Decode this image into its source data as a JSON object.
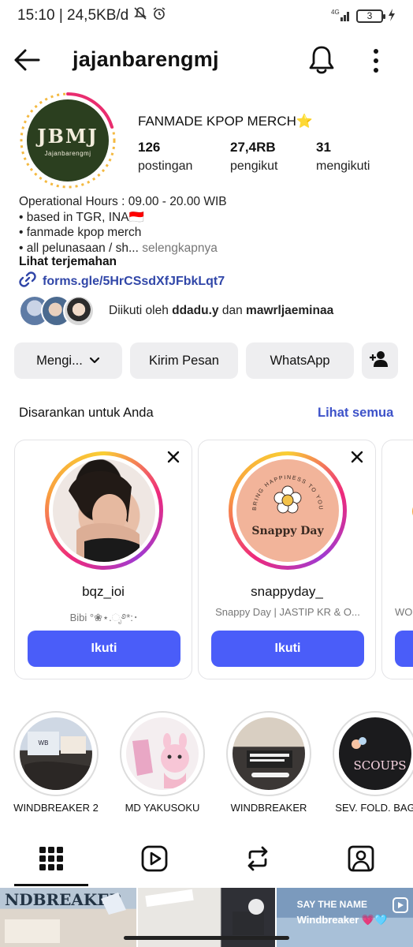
{
  "status_bar": {
    "time_info": "15:10 | 24,5KB/d",
    "network": "4G",
    "battery": "3"
  },
  "header": {
    "username": "jajanbarengmj",
    "back_icon": "arrow-left-icon",
    "bell_icon": "bell-icon",
    "more_icon": "more-vertical-icon"
  },
  "profile": {
    "avatar_logo": "JBMJ",
    "avatar_sub": "Jajanbarengmj",
    "display_name": "FANMADE KPOP MERCH⭐",
    "posts_count": "126",
    "posts_label": "postingan",
    "followers_count": "27,4RB",
    "followers_label": "pengikut",
    "following_count": "31",
    "following_label": "mengikuti"
  },
  "bio": {
    "line1": "Operational Hours : 09.00 - 20.00 WIB",
    "line2": "• based in TGR, INA🇮🇩",
    "line3": "• fanmade kpop merch",
    "line4": "• all pelunasaan / sh...",
    "more": "selengkapnya",
    "translate": "Lihat terjemahan",
    "link": "forms.gle/5HrCSsdXfJFbkLqt7"
  },
  "followed_by": {
    "prefix": "Diikuti oleh",
    "user1": "ddadu.y",
    "joiner": "dan",
    "user2": "mawrljaeminaa"
  },
  "actions": {
    "following": "Mengi...",
    "message": "Kirim Pesan",
    "whatsapp": "WhatsApp"
  },
  "suggestions": {
    "title": "Disarankan untuk Anda",
    "see_all": "Lihat semua",
    "cards": [
      {
        "username": "bqz_ioi",
        "desc": "Bibi °❀⋆.ೃ࿔*:･",
        "follow": "Ikuti"
      },
      {
        "username": "snappyday_",
        "desc": "Snappy Day | JASTIP KR & O...",
        "follow": "Ikuti",
        "logo": "Snappy Day",
        "ring_text": "BRING HAPPINESS TO YOU"
      },
      {
        "desc": "WO"
      }
    ]
  },
  "highlights": [
    {
      "label": "WINDBREAKER 2"
    },
    {
      "label": "MD YAKUSOKU"
    },
    {
      "label": "WINDBREAKER"
    },
    {
      "label": "SEV. FOLD. BAG"
    }
  ],
  "tabs": [
    "grid-icon",
    "reels-icon",
    "repost-icon",
    "tagged-icon"
  ],
  "grid": {
    "cell3_line1": "SAY THE NAME",
    "cell3_line2": "Windbreaker 💗🩵"
  },
  "colors": {
    "accent": "#4a5df9",
    "link": "#3046a8",
    "button_bg": "#eeeef0"
  }
}
